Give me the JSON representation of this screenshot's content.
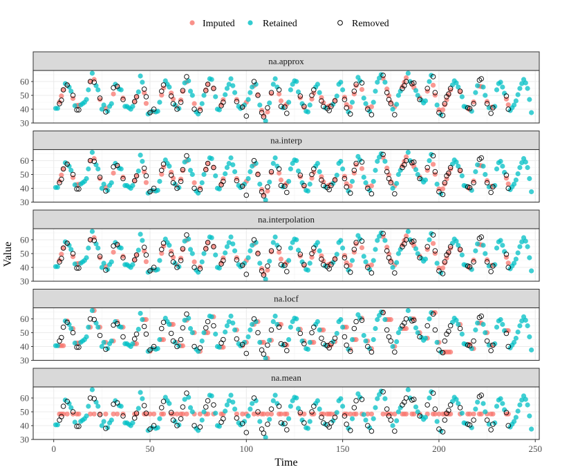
{
  "chart_data": {
    "type": "scatter",
    "title": "",
    "xlabel": "Time",
    "ylabel": "Value",
    "xlim": [
      -10,
      252
    ],
    "ylim": [
      30,
      68
    ],
    "x_ticks": [
      0,
      50,
      100,
      150,
      200,
      250
    ],
    "y_ticks": [
      30,
      40,
      50,
      60
    ],
    "grid": true,
    "legend": {
      "placement": "top",
      "entries": [
        {
          "name": "Imputed",
          "color": "#F8766D",
          "shape": "filled-circle"
        },
        {
          "name": "Retained",
          "color": "#00BFC4",
          "shape": "filled-circle"
        },
        {
          "name": "Removed",
          "color": "#000000",
          "shape": "open-circle"
        }
      ]
    },
    "facets": [
      "na.approx",
      "na.interp",
      "na.interpolation",
      "na.locf",
      "na.mean"
    ],
    "time": "1..240",
    "original": [
      40.6,
      40.6,
      44.0,
      46.5,
      54.0,
      58.5,
      57.5,
      56.0,
      53.0,
      50.0,
      42.5,
      39.5,
      39.5,
      43.0,
      44.0,
      45.0,
      47.0,
      54.0,
      60.0,
      66.0,
      59.5,
      57.0,
      54.0,
      48.0,
      40.0,
      43.0,
      38.0,
      38.5,
      42.0,
      44.0,
      55.5,
      58.0,
      56.5,
      54.5,
      54.0,
      47.0,
      42.0,
      42.0,
      41.0,
      40.0,
      42.0,
      45.5,
      49.0,
      52.5,
      64.0,
      59.5,
      54.5,
      49.0,
      36.5,
      37.5,
      38.5,
      40.0,
      38.0,
      38.5,
      45.0,
      53.0,
      57.5,
      60.5,
      58.0,
      56.0,
      49.5,
      44.0,
      43.0,
      40.0,
      40.5,
      45.0,
      53.5,
      59.0,
      63.5,
      60.5,
      53.0,
      50.0,
      40.0,
      38.0,
      36.5,
      39.0,
      44.0,
      50.0,
      53.5,
      58.0,
      62.0,
      61.5,
      55.0,
      49.0,
      40.0,
      39.5,
      42.5,
      45.0,
      50.5,
      55.0,
      58.0,
      62.0,
      57.0,
      52.0,
      45.5,
      42.0,
      40.5,
      41.5,
      43.0,
      35.0,
      47.0,
      52.0,
      56.0,
      60.0,
      58.0,
      50.0,
      43.0,
      37.5,
      34.5,
      31.5,
      41.0,
      44.5,
      52.0,
      58.0,
      62.0,
      56.0,
      54.0,
      42.0,
      41.0,
      41.5,
      37.0,
      45.0,
      54.0,
      58.0,
      60.5,
      60.0,
      52.5,
      49.5,
      44.0,
      42.0,
      38.5,
      38.0,
      43.0,
      50.0,
      54.0,
      56.0,
      58.0,
      52.0,
      46.0,
      42.0,
      41.0,
      40.5,
      39.0,
      42.0,
      43.5,
      46.0,
      49.5,
      58.0,
      59.5,
      54.0,
      47.0,
      41.0,
      38.0,
      36.5,
      45.0,
      53.0,
      58.0,
      63.0,
      60.5,
      59.0,
      48.0,
      44.0,
      40.0,
      38.5,
      36.0,
      45.0,
      53.0,
      59.5,
      62.5,
      65.0,
      64.5,
      59.5,
      52.0,
      47.0,
      44.0,
      40.0,
      36.0,
      43.5,
      50.0,
      53.0,
      55.0,
      57.0,
      60.0,
      66.0,
      60.0,
      58.5,
      59.0,
      53.5,
      50.0,
      47.0,
      46.5,
      44.5,
      46.0,
      55.0,
      60.0,
      64.5,
      63.5,
      52.0,
      43.0,
      37.5,
      36.0,
      35.5,
      44.0,
      49.0,
      51.0,
      55.0,
      57.5,
      60.5,
      59.0,
      56.0,
      53.0,
      49.0,
      42.0,
      41.5,
      41.0,
      40.5,
      38.5,
      44.0,
      52.0,
      57.0,
      61.0,
      62.0,
      56.0,
      50.0,
      44.0,
      41.0,
      37.0,
      41.0,
      42.0,
      54.0,
      58.5,
      59.5,
      56.0,
      51.5,
      49.5,
      40.0,
      39.0,
      41.0,
      43.0,
      46.0,
      50.5,
      55.0,
      58.5,
      61.5,
      59.0,
      55.0,
      47.0,
      37.5
    ],
    "removed": [
      3,
      4,
      5,
      7,
      10,
      12,
      13,
      19,
      21,
      24,
      27,
      31,
      33,
      36,
      42,
      43,
      47,
      48,
      50,
      52,
      56,
      57,
      61,
      62,
      64,
      66,
      67,
      69,
      73,
      76,
      79,
      80,
      83,
      87,
      88,
      95,
      98,
      100,
      104,
      106,
      108,
      109,
      111,
      113,
      117,
      118,
      120,
      121,
      128,
      130,
      134,
      135,
      139,
      140,
      142,
      143,
      144,
      146,
      151,
      152,
      154,
      156,
      157,
      160,
      163,
      165,
      171,
      173,
      174,
      175,
      177,
      181,
      182,
      183,
      186,
      187,
      190,
      194,
      197,
      198,
      200,
      202,
      203,
      204,
      205,
      206,
      211,
      215,
      216,
      218,
      221,
      222,
      225,
      227,
      228,
      235,
      236
    ],
    "mean_imputed_value": 48.4
  }
}
